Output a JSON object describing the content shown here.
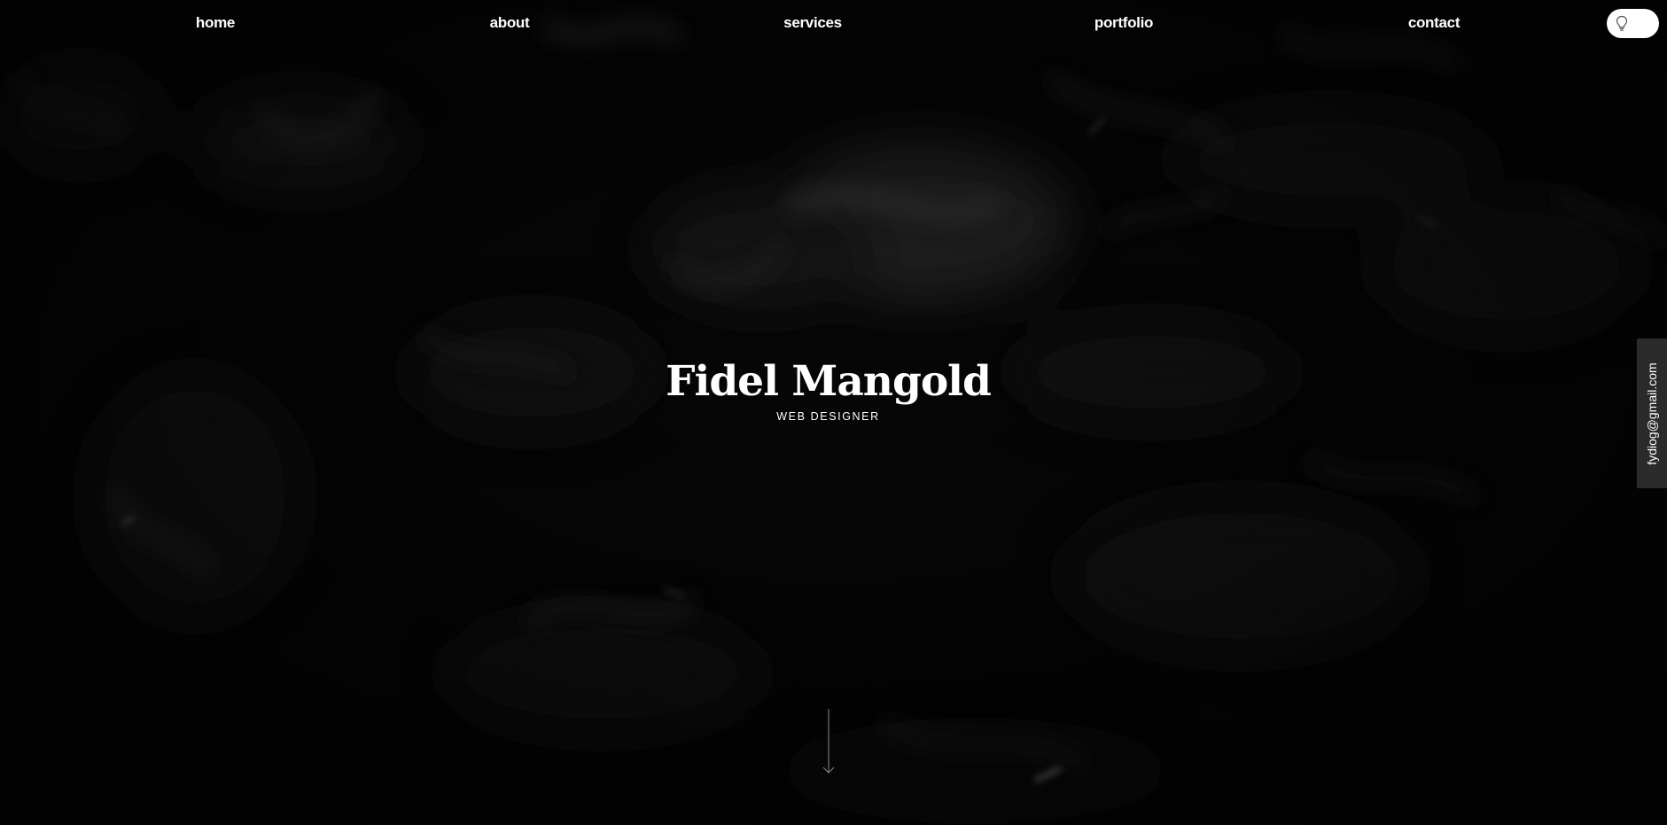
{
  "nav": {
    "links": [
      {
        "label": "home"
      },
      {
        "label": "about"
      },
      {
        "label": "services"
      },
      {
        "label": "portfolio"
      },
      {
        "label": "contact"
      }
    ],
    "theme_toggle_icon": "lightbulb-icon"
  },
  "hero": {
    "name": "Fidel Mangold",
    "role": "WEB DESIGNER"
  },
  "side_tab": {
    "email": "fydiog@gmail.com"
  },
  "scroll": {
    "icon": "arrow-down-icon"
  },
  "colors": {
    "background": "#060606",
    "text": "#ffffff",
    "side_tab": "#2b2b2b",
    "toggle": "#ffffff"
  }
}
